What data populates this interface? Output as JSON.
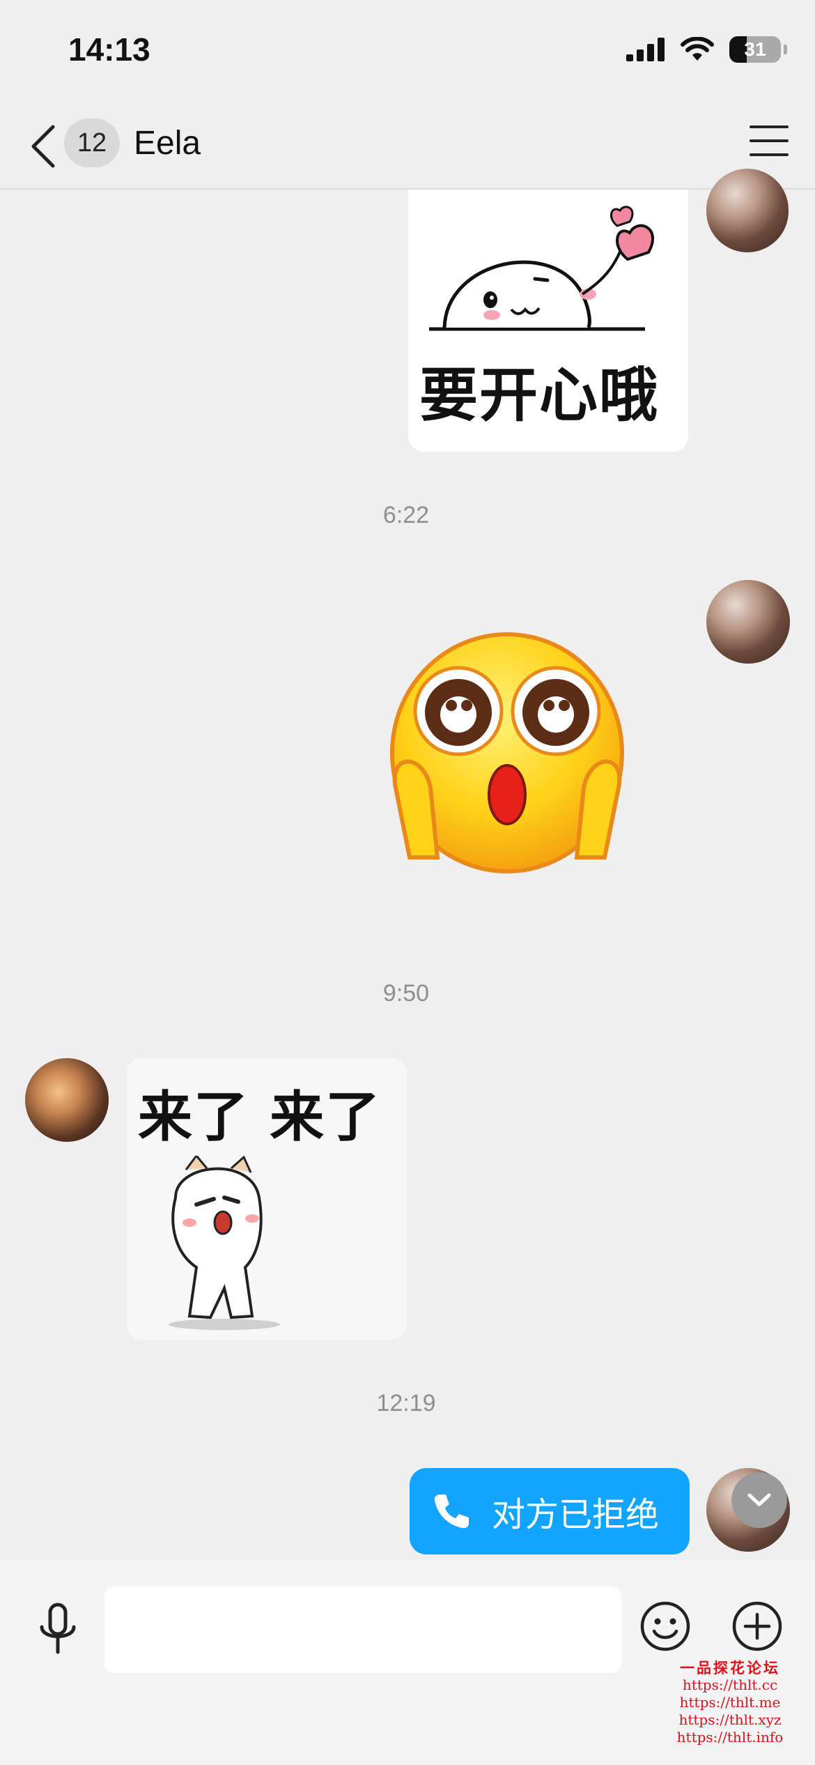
{
  "status_bar": {
    "time": "14:13",
    "battery": "31"
  },
  "nav": {
    "unread_count": "12",
    "title": "Eela"
  },
  "messages": {
    "sticker1_text": "要开心哦",
    "time1": "6:22",
    "time2": "9:50",
    "sticker3_text": "来了 来了",
    "time3": "12:19",
    "call_status": "对方已拒绝"
  },
  "watermark": {
    "title": "一品探花论坛",
    "urls": [
      "https://thlt.cc",
      "https://thlt.me",
      "https://thlt.xyz",
      "https://thlt.info"
    ]
  },
  "colors": {
    "accent_blue": "#12a4ff",
    "background": "#efefef"
  },
  "icons": [
    "back-chevron-icon",
    "menu-icon",
    "phone-icon",
    "chevron-down-icon",
    "microphone-icon",
    "emoji-icon",
    "plus-circle-icon",
    "signal-icon",
    "wifi-icon",
    "battery-icon"
  ]
}
